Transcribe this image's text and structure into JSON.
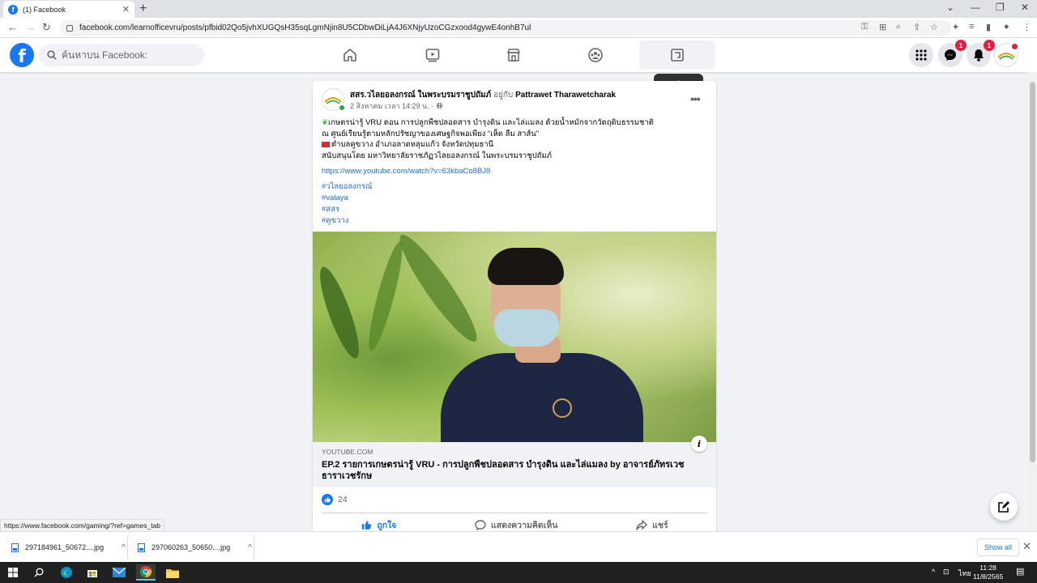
{
  "browser": {
    "tab_title": "(1) Facebook",
    "url": "facebook.com/learnofficevru/posts/pfbid02Qo5jvhXUGQsH35sqLgmNjin8U5CDbwDiLjA4J6XNjyUzoCGzxood4gywE4onhB7ul",
    "status_url": "https://www.facebook.com/gaming/?ref=games_tab"
  },
  "fb": {
    "logo": "f",
    "search_placeholder": "ค้นหาบน Facebook:",
    "tooltip": "การเล่นเกม",
    "messenger_badge": "1",
    "notif_badge": "1"
  },
  "post": {
    "author": "สสร.วไลยอลงกรณ์ ในพระบรมราชูปถัมภ์",
    "with_text": "อยู่กับ",
    "tagged": "Pattrawet Tharawetcharak",
    "date": "2 สิงหาคม เวลา 14:29 น. ·",
    "line1": "เกษตรน่ารู้ VRU ตอน การปลูกพืชปลอดสาร บำรุงดิน และไล่แมลง ด้วยน้ำหมักจากวัตถุดิบธรรมชาติ",
    "line2": "ณ ศูนย์เรียนรู้ตามหลักปรัชญาของเศษฐกิจพอเพียง \"เห็ด ลืม สาส์น\"",
    "line3": "ตำบลคูขวาง อำเภอลาดหลุมแก้ว จังหวัดปทุมธานี",
    "line4": "สนับสนุนโดย มหาวิทยาลัยราชภัฏวไลยอลงกรณ์ ในพระบรมราชูปถัมภ์",
    "link": "https://www.youtube.com/watch?v=63kbaCo8BJ8",
    "tags": [
      "#วไลยอลงกรณ์",
      "#valaya",
      "#สสร",
      "#คูขวาง"
    ],
    "link_domain": "YOUTUBE.COM",
    "link_title": "EP.2 รายการเกษตรน่ารู้ VRU - การปลูกพืชปลอดสาร บำรุงดิน และไล่แมลง by อาจารย์ภัทรเวช ธาราเวชรักษ",
    "like_count": "24",
    "like_label": "ถูกใจ",
    "comment_label": "แสดงความคิดเห็น",
    "share_label": "แชร์"
  },
  "downloads": {
    "file1": "297184961_50672....jpg",
    "file2": "297060263_50650....jpg",
    "show_all": "Show all"
  },
  "taskbar": {
    "lang": "ไทย",
    "time": "11:28",
    "date": "11/8/2565"
  },
  "colors": {
    "fb_blue": "#1877f2",
    "badge_red": "#e41e3f",
    "link_blue": "#216fdb"
  }
}
